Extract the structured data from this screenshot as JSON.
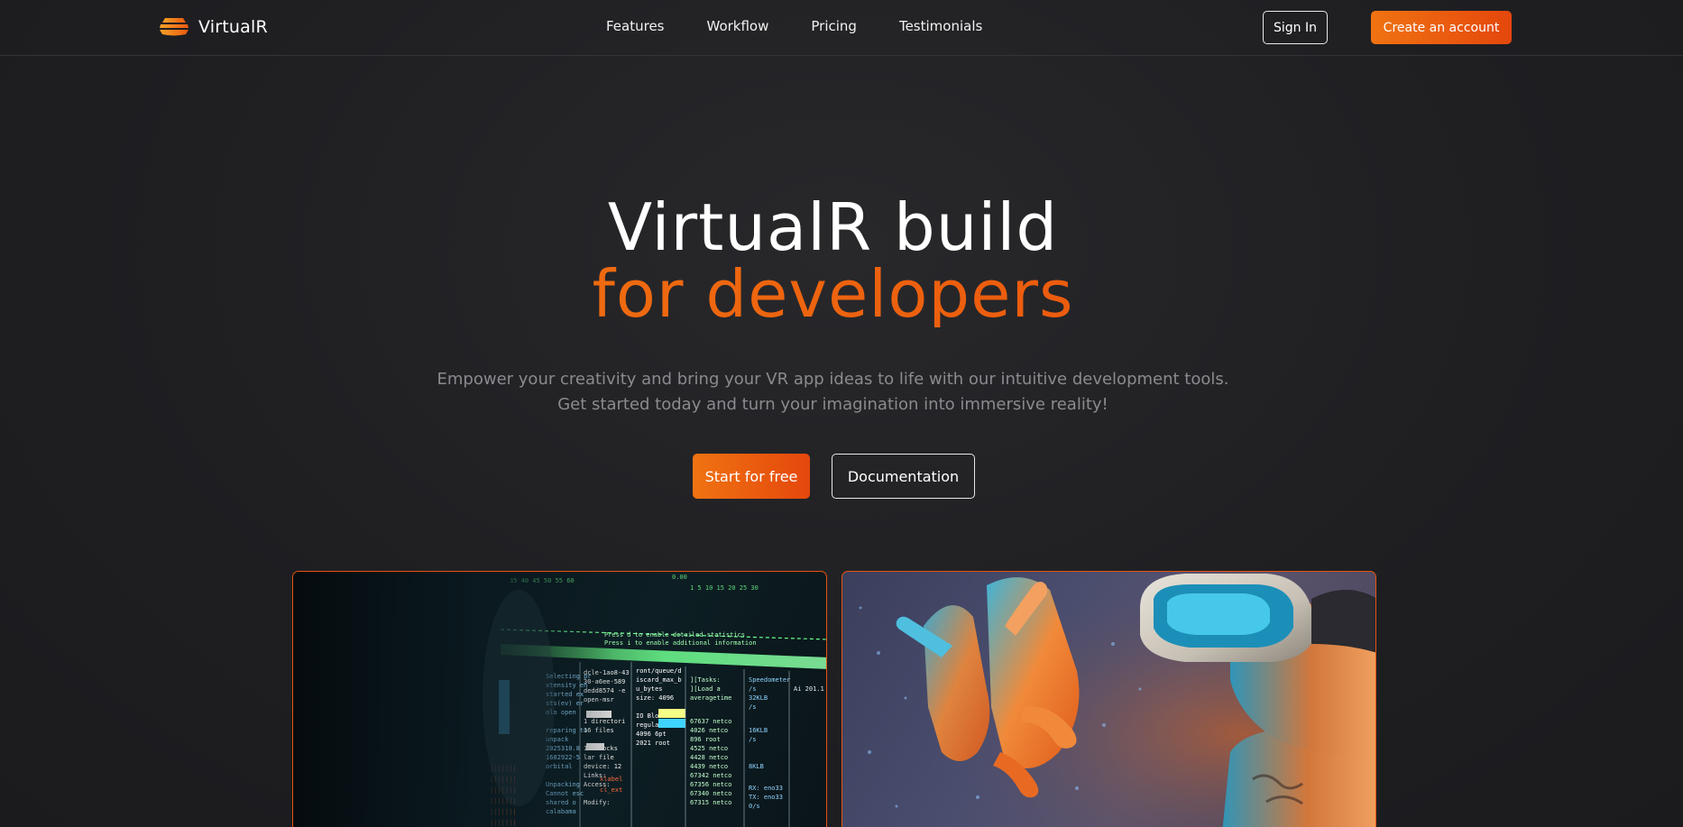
{
  "nav": {
    "brand": "VirtualR",
    "links": [
      "Features",
      "Workflow",
      "Pricing",
      "Testimonials"
    ],
    "sign_in": "Sign In",
    "create_account": "Create an account"
  },
  "hero": {
    "title_line1": "VirtualR build",
    "title_line2": "for developers",
    "subtitle_line1": "Empower your creativity and bring your VR app ideas to life with our intuitive development tools.",
    "subtitle_line2": "Get started today and turn your imagination into immersive reality!",
    "primary_cta": "Start for free",
    "secondary_cta": "Documentation"
  },
  "theme": {
    "accent_start": "#f07312",
    "accent_end": "#e4470c",
    "background": "#1e1e21"
  },
  "icons": {
    "logo": "layered-disc-logo-icon"
  }
}
